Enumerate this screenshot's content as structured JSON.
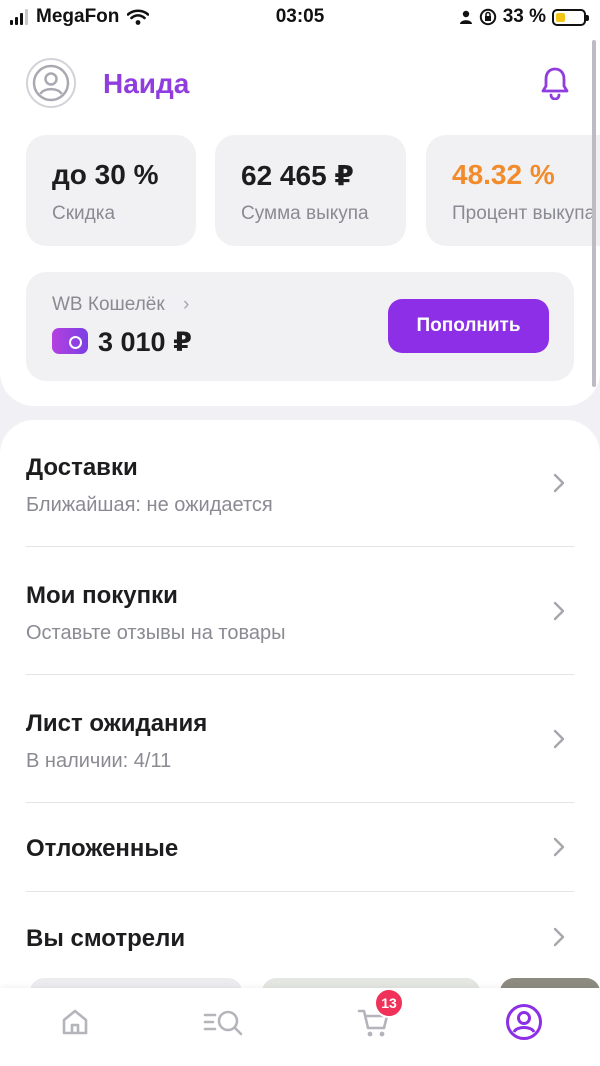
{
  "status_bar": {
    "carrier": "MegaFon",
    "time": "03:05",
    "battery": "33 %"
  },
  "header": {
    "user_name": "Наида"
  },
  "stats": [
    {
      "value": "до 30 %",
      "label": "Скидка"
    },
    {
      "value": "62 465 ₽",
      "label": "Сумма выкупа"
    },
    {
      "value": "48.32 %",
      "label": "Процент выкупа"
    }
  ],
  "wallet": {
    "title": "WB Кошелёк",
    "amount": "3 010 ₽",
    "topup_label": "Пополнить"
  },
  "menu": [
    {
      "title": "Доставки",
      "subtitle": "Ближайшая: не ожидается"
    },
    {
      "title": "Мои покупки",
      "subtitle": "Оставьте отзывы на товары"
    },
    {
      "title": "Лист ожидания",
      "subtitle": "В наличии: 4/11"
    },
    {
      "title": "Отложенные"
    },
    {
      "title": "Вы смотрели"
    }
  ],
  "bottom_nav": {
    "cart_badge": "13",
    "items": [
      "home-icon",
      "catalog-search-icon",
      "cart-icon",
      "profile-icon"
    ]
  },
  "colors": {
    "accent": "#8c2fe6",
    "name": "#8f3dde",
    "orange": "#f28b2c",
    "badge": "#f0315a"
  }
}
